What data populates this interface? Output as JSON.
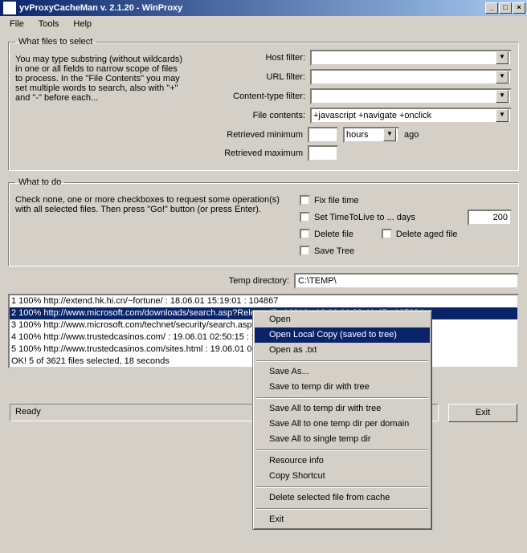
{
  "window": {
    "title": "yvProxyCacheMan v. 2.1.20 - WinProxy"
  },
  "menus": {
    "file": "File",
    "tools": "Tools",
    "help": "Help"
  },
  "select": {
    "legend": "What files to select",
    "help": "You may type substring (without wildcards) in one or all fields to narrow scope of files to process. In the \"File Contents\" you may set multiple words to search, also with \"+\" and \"-\" before each...",
    "host_label": "Host filter:",
    "url_label": "URL filter:",
    "ct_label": "Content-type filter:",
    "fc_label": "File contents:",
    "fc_value": "+javascript +navigate +onclick",
    "ret_min": "Retrieved minimum",
    "ret_max": "Retrieved maximum",
    "time_unit": "hours",
    "ago": "ago"
  },
  "todo": {
    "legend": "What to do",
    "help": "Check none, one or more checkboxes to request some operation(s) with all selected files. Then press \"Go!\" button (or press Enter).",
    "fix_time": "Fix file time",
    "set_ttl": "Set TimeToLive to ... days",
    "ttl_value": "200",
    "delete_file": "Delete file",
    "delete_aged": "Delete aged file",
    "save_tree": "Save Tree"
  },
  "temp": {
    "label": "Temp directory:",
    "value": "C:\\TEMP\\"
  },
  "list": {
    "items": [
      "1 100% http://extend.hk.hi.cn/~fortune/ : 18.06.01 15:19:01 : 104867",
      "2 100% http://www.microsoft.com/downloads/search.asp?ReleaseID=16810 : 18.06.01 22:41:45 : 107824",
      "3 100% http://www.microsoft.com/technet/security/search.asp : 18.06.01 22:43:30 : 60581",
      "4 100% http://www.trustedcasinos.com/ : 19.06.01 02:50:15 : 52014",
      "5 100% http://www.trustedcasinos.com/sites.html : 19.06.01 02:50:20 : 48920",
      "OK! 5 of 3621 files selected, 18 seconds"
    ],
    "selected_index": 1
  },
  "status": {
    "ready": "Ready",
    "exit": "Exit"
  },
  "context": {
    "open": "Open",
    "open_local": "Open Local Copy (saved to tree)",
    "open_txt": "Open as .txt",
    "save_as": "Save As...",
    "save_tree": "Save to temp dir with tree",
    "save_all_tree": "Save All to temp dir with tree",
    "save_all_domain": "Save All to one temp dir per domain",
    "save_all_single": "Save All to single temp dir",
    "res_info": "Resource info",
    "copy_shortcut": "Copy Shortcut",
    "delete_sel": "Delete selected file from cache",
    "exit": "Exit"
  }
}
